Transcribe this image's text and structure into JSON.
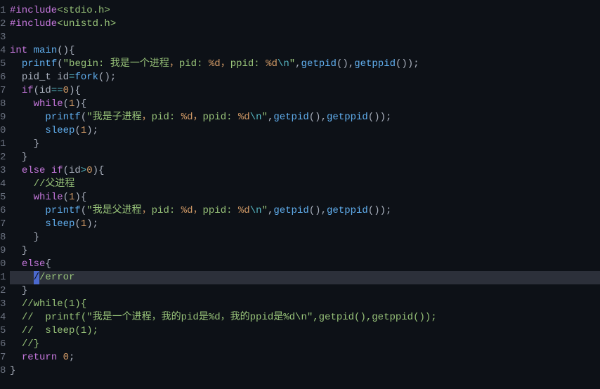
{
  "tabhint": "",
  "gutter": [
    "1",
    "2",
    "3",
    "4",
    "5",
    "6",
    "7",
    "8",
    "9",
    "0",
    "1",
    "2",
    "3",
    "4",
    "5",
    "6",
    "7",
    "8",
    "9",
    "0",
    "1",
    "2",
    "3",
    "4",
    "5",
    "6",
    "7",
    "8"
  ],
  "code": {
    "l1": {
      "pre": "#include",
      "inc": "<stdio.h>"
    },
    "l2": {
      "pre": "#include",
      "inc": "<unistd.h>"
    },
    "l4": {
      "kw": "int",
      "fn": "main",
      "rest": "(){"
    },
    "l5": {
      "fn": "printf",
      "open": "(",
      "s1": "\"begin: 我是一个进程",
      "comma1": "，",
      "s2": "pid: ",
      "fmt1": "%d",
      "comma2": "，",
      "s3": "ppid: ",
      "fmt2": "%d",
      "esc": "\\n",
      "close": "\"",
      "p1": ",",
      "fn2": "getpid",
      "args2": "(),",
      "fn3": "getppid",
      "args3": "());"
    },
    "l6": {
      "t": "pid_t id",
      "op": "=",
      "fn": "fork",
      "rest": "();"
    },
    "l7": {
      "kw": "if",
      "open": "(id",
      "op": "==",
      "num": "0",
      "close": "){"
    },
    "l8": {
      "kw": "while",
      "open": "(",
      "num": "1",
      "close": "){"
    },
    "l9": {
      "fn": "printf",
      "open": "(",
      "s1": "\"我是子进程",
      "c1": "，",
      "s2": "pid: ",
      "fmt1": "%d",
      "c2": "，",
      "s3": "ppid: ",
      "fmt2": "%d",
      "esc": "\\n",
      "close": "\"",
      "p": ",",
      "fn2": "getpid",
      "a2": "(),",
      "fn3": "getppid",
      "a3": "());"
    },
    "l10": {
      "fn": "sleep",
      "open": "(",
      "num": "1",
      "close": ");"
    },
    "l11": {
      "brace": "}"
    },
    "l12": {
      "brace": "}"
    },
    "l13": {
      "kw": "else if",
      "open": "(id",
      "op": ">",
      "num": "0",
      "close": "){"
    },
    "l14": {
      "cmt": "//父进程"
    },
    "l15": {
      "kw": "while",
      "open": "(",
      "num": "1",
      "close": "){"
    },
    "l16": {
      "fn": "printf",
      "open": "(",
      "s1": "\"我是父进程",
      "c1": "，",
      "s2": "pid: ",
      "fmt1": "%d",
      "c2": "，",
      "s3": "ppid: ",
      "fmt2": "%d",
      "esc": "\\n",
      "close": "\"",
      "p": ",",
      "fn2": "getpid",
      "a2": "(),",
      "fn3": "getppid",
      "a3": "());"
    },
    "l17": {
      "fn": "sleep",
      "open": "(",
      "num": "1",
      "close": ");"
    },
    "l18": {
      "brace": "}"
    },
    "l19": {
      "brace": "}"
    },
    "l20": {
      "kw": "else",
      "brace": "{"
    },
    "l21": {
      "cursor": "/",
      "cmt": "/error"
    },
    "l22": {
      "brace": "}"
    },
    "l23": {
      "cmt": "//while(1){"
    },
    "l24": {
      "cmt": "//  printf(\"我是一个进程，我的pid是%d，我的ppid是%d\\n\",getpid(),getppid());"
    },
    "l25": {
      "cmt": "//  sleep(1);"
    },
    "l26": {
      "cmt": "//}"
    },
    "l27": {
      "kw": "return",
      "sp": " ",
      "num": "0",
      "semi": ";"
    },
    "l28": {
      "brace": "}"
    }
  }
}
